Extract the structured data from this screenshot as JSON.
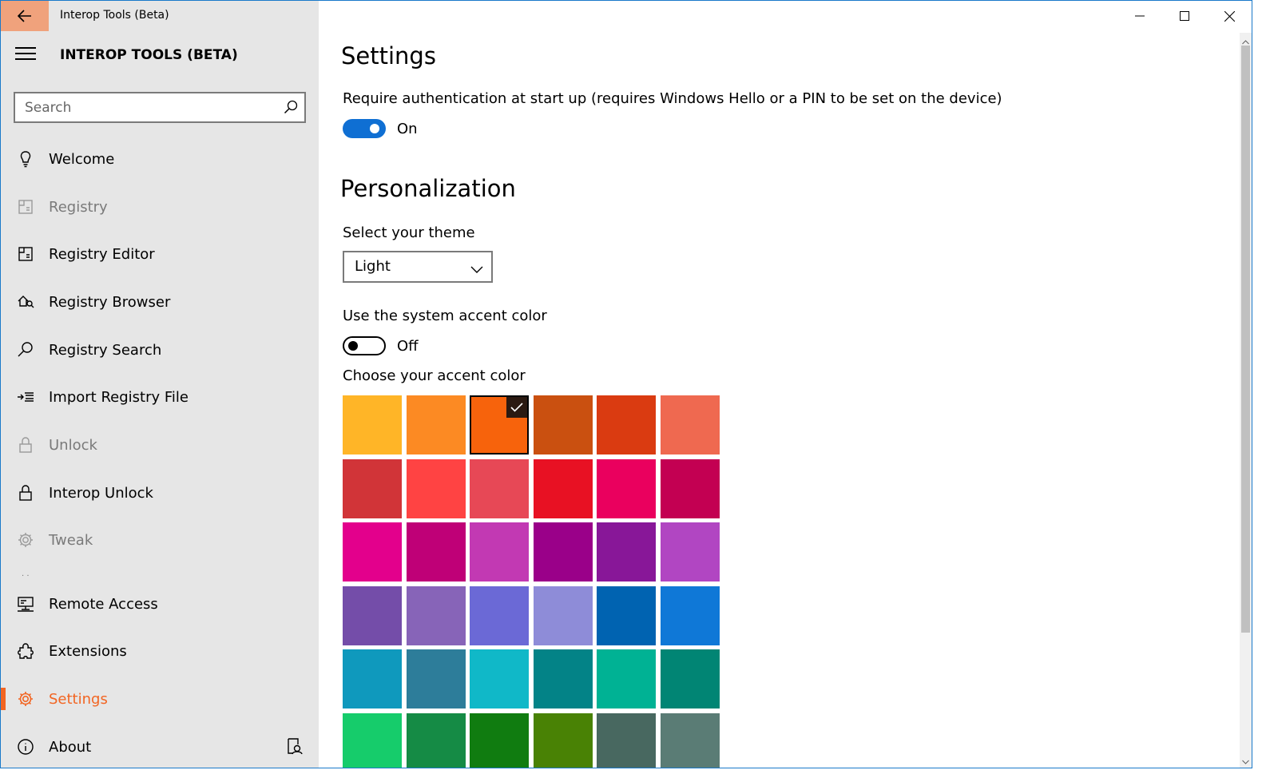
{
  "window": {
    "title": "Interop Tools (Beta)"
  },
  "sidebar": {
    "title": "INTEROP TOOLS (BETA)",
    "search_placeholder": "Search",
    "items": [
      {
        "label": "Welcome",
        "icon": "lightbulb-icon",
        "state": "normal"
      },
      {
        "label": "Registry",
        "icon": "registry-icon",
        "state": "disabled"
      },
      {
        "label": "Registry Editor",
        "icon": "registry-editor-icon",
        "state": "normal"
      },
      {
        "label": "Registry Browser",
        "icon": "registry-browser-icon",
        "state": "normal"
      },
      {
        "label": "Registry Search",
        "icon": "search-icon",
        "state": "normal"
      },
      {
        "label": "Import Registry File",
        "icon": "import-icon",
        "state": "normal"
      },
      {
        "label": "Unlock",
        "icon": "lock-icon",
        "state": "disabled"
      },
      {
        "label": "Interop Unlock",
        "icon": "lock-icon",
        "state": "normal"
      },
      {
        "label": "Tweak",
        "icon": "gear-icon",
        "state": "disabled"
      },
      {
        "label": "Remote Access",
        "icon": "remote-desktop-icon",
        "state": "normal"
      },
      {
        "label": "Extensions",
        "icon": "puzzle-icon",
        "state": "normal"
      },
      {
        "label": "Settings",
        "icon": "gear-icon",
        "state": "active"
      },
      {
        "label": "About",
        "icon": "info-icon",
        "state": "normal"
      }
    ]
  },
  "main": {
    "title": "Settings",
    "auth": {
      "label": "Require authentication at start up (requires Windows Hello or a PIN to be set on the device)",
      "state": "On"
    },
    "personalization": {
      "title": "Personalization",
      "theme_label": "Select your theme",
      "theme_value": "Light",
      "system_accent_label": "Use the system accent color",
      "system_accent_state": "Off",
      "accent_label": "Choose your accent color"
    },
    "accent_colors": [
      "#ffb527",
      "#fc8a23",
      "#f7630c",
      "#ca5010",
      "#da3b11",
      "#ef6950",
      "#d13438",
      "#ff4343",
      "#e74856",
      "#e81123",
      "#ea005e",
      "#c30052",
      "#e3008c",
      "#bf0077",
      "#c239b3",
      "#9a0089",
      "#881798",
      "#b146c2",
      "#744da9",
      "#8764b8",
      "#6b69d6",
      "#8e8cd8",
      "#0063b1",
      "#0f78d7",
      "#0f99bd",
      "#2d7d9a",
      "#10b8c8",
      "#038387",
      "#00b294",
      "#018574",
      "#16cc6b",
      "#158b45",
      "#107c10",
      "#498205",
      "#486860",
      "#5a7c75"
    ],
    "selected_accent": "#f7630c"
  }
}
